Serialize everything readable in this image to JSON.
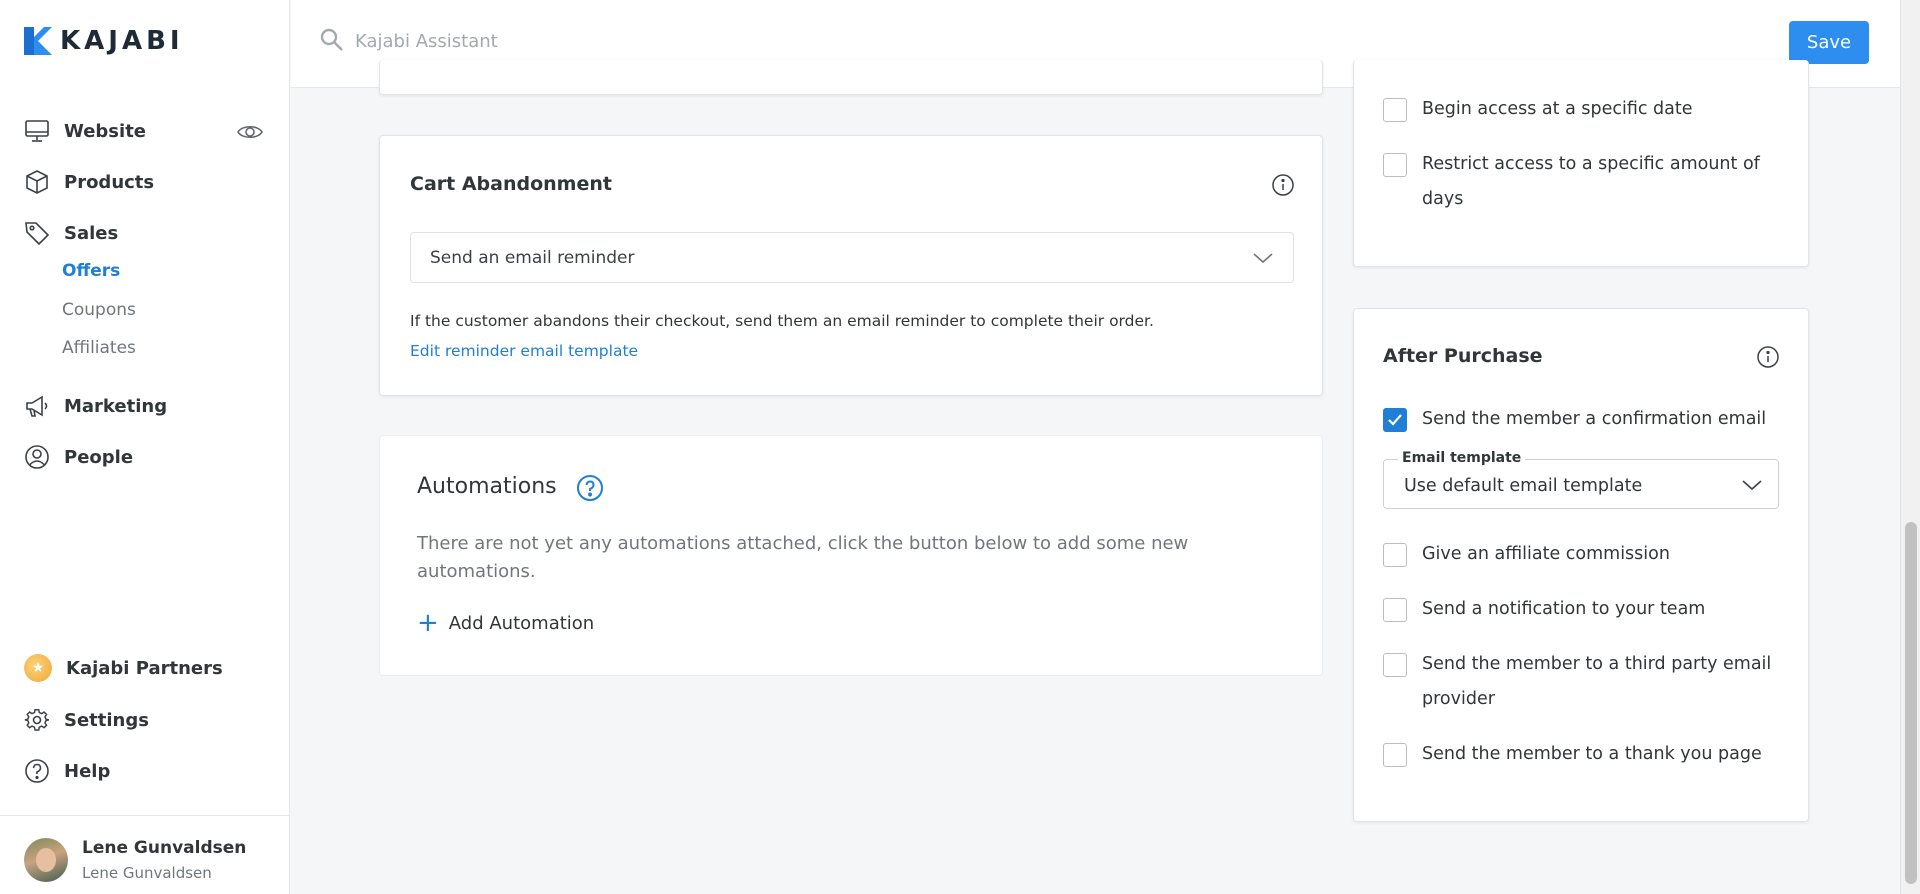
{
  "brand": {
    "name": "KAJABI",
    "accent": "#2d8ef0"
  },
  "search": {
    "placeholder": "Kajabi Assistant"
  },
  "toolbar": {
    "save_label": "Save"
  },
  "sidebar": {
    "items": [
      {
        "label": "Website",
        "icon": "monitor-icon"
      },
      {
        "label": "Products",
        "icon": "cube-icon"
      },
      {
        "label": "Sales",
        "icon": "tag-icon"
      },
      {
        "label": "Marketing",
        "icon": "megaphone-icon"
      },
      {
        "label": "People",
        "icon": "user-circle-icon"
      }
    ],
    "sales_sub": [
      {
        "label": "Offers",
        "active": true
      },
      {
        "label": "Coupons",
        "active": false
      },
      {
        "label": "Affiliates",
        "active": false
      }
    ],
    "bottom": [
      {
        "label": "Kajabi Partners",
        "icon": "star-badge-icon"
      },
      {
        "label": "Settings",
        "icon": "gear-icon"
      },
      {
        "label": "Help",
        "icon": "help-icon"
      }
    ],
    "user": {
      "name": "Lene Gunvaldsen",
      "subtitle": "Lene Gunvaldsen"
    }
  },
  "cart": {
    "title": "Cart Abandonment",
    "select_value": "Send an email reminder",
    "helper": "If the customer abandons their checkout, send them an email reminder to complete their order.",
    "link": "Edit reminder email template"
  },
  "automations": {
    "title": "Automations",
    "empty_text": "There are not yet any automations attached, click the button below to add some new automations.",
    "add_label": "Add Automation"
  },
  "access": {
    "options": [
      {
        "label": "Begin access at a specific date",
        "checked": false
      },
      {
        "label": "Restrict access to a specific amount of days",
        "checked": false
      }
    ]
  },
  "after_purchase": {
    "title": "After Purchase",
    "confirmation": {
      "label": "Send the member a confirmation email",
      "checked": true
    },
    "email_template": {
      "label": "Email template",
      "value": "Use default email template"
    },
    "options": [
      {
        "label": "Give an affiliate commission",
        "checked": false
      },
      {
        "label": "Send a notification to your team",
        "checked": false
      },
      {
        "label": "Send the member to a third party email provider",
        "checked": false
      },
      {
        "label": "Send the member to a thank you page",
        "checked": false
      }
    ]
  }
}
